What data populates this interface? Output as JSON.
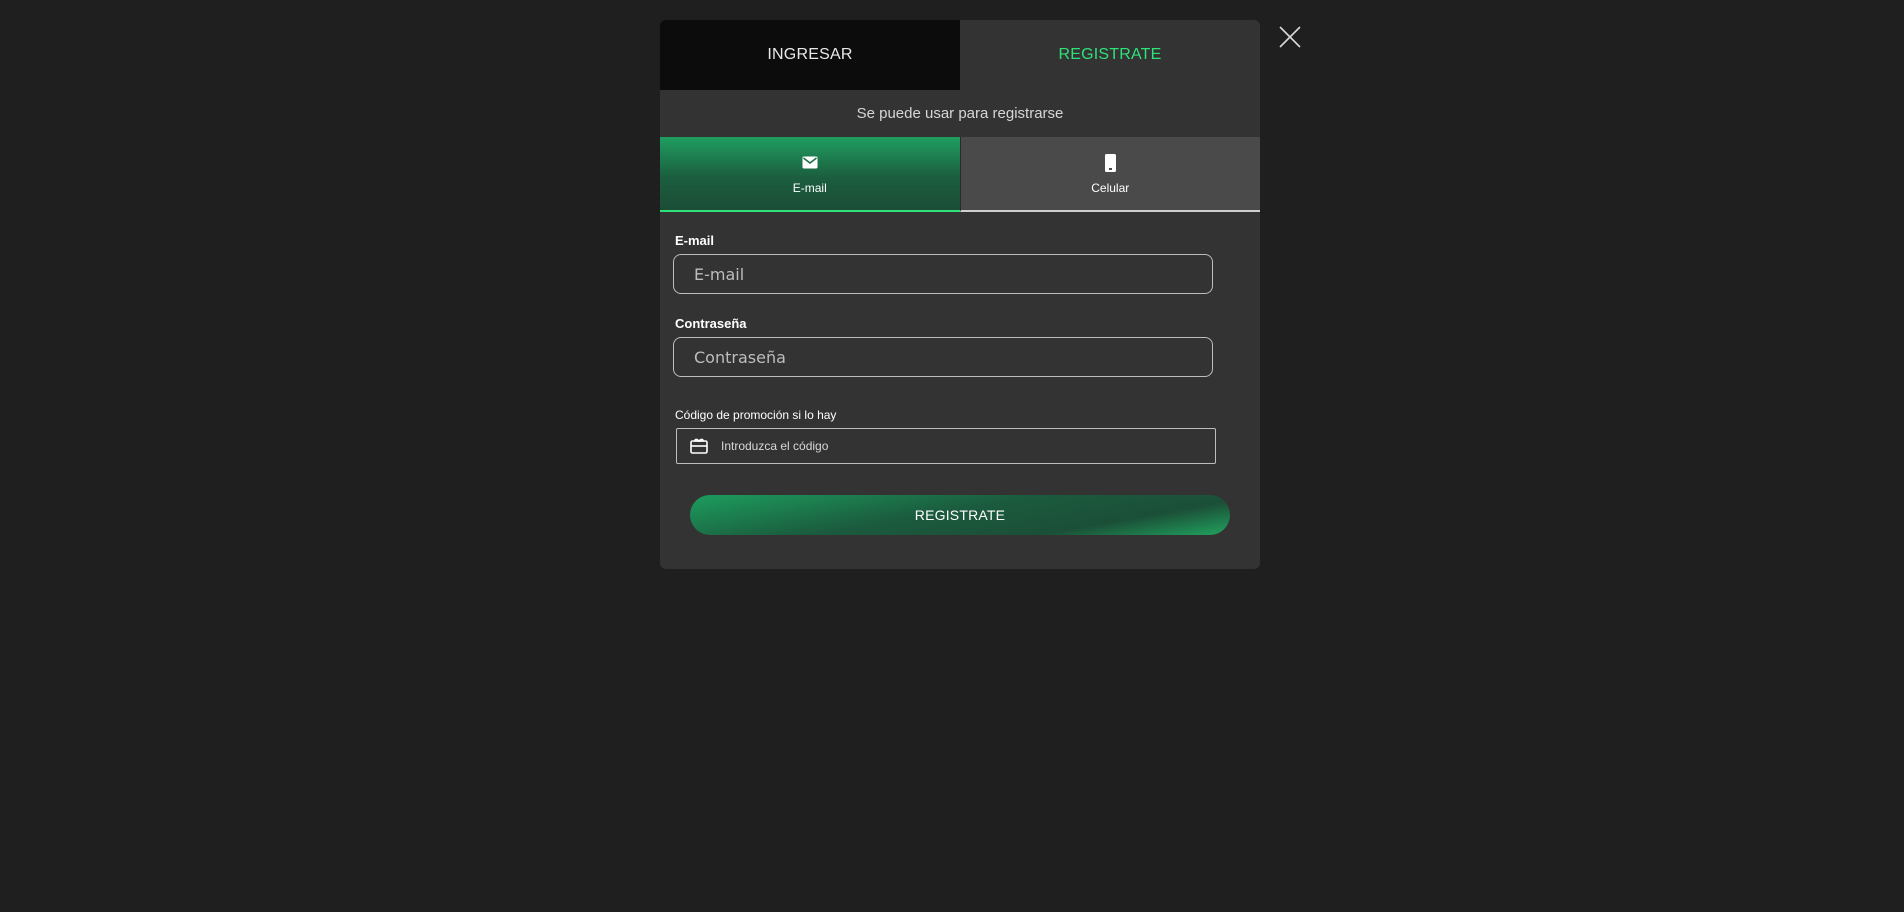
{
  "modal": {
    "tabs": {
      "login_label": "INGRESAR",
      "register_label": "REGISTRATE"
    },
    "hint": "Se puede usar para registrarse",
    "methods": {
      "email_label": "E-mail",
      "phone_label": "Celular"
    },
    "form": {
      "email_label": "E-mail",
      "email_placeholder": "E-mail",
      "email_value": "",
      "password_label": "Contraseña",
      "password_placeholder": "Contraseña",
      "password_value": "",
      "promo_label": "Código de promoción si lo hay",
      "promo_placeholder": "Introduzca el código",
      "promo_value": "",
      "submit_label": "REGISTRATE"
    }
  },
  "icons": {
    "close": "close-icon",
    "email": "envelope-icon",
    "phone": "mobile-phone-icon",
    "promo": "gift-card-icon"
  },
  "colors": {
    "background": "#1f1f1f",
    "modal": "#333333",
    "accent": "#2ee27a",
    "login_tab": "#0d0c0c"
  }
}
